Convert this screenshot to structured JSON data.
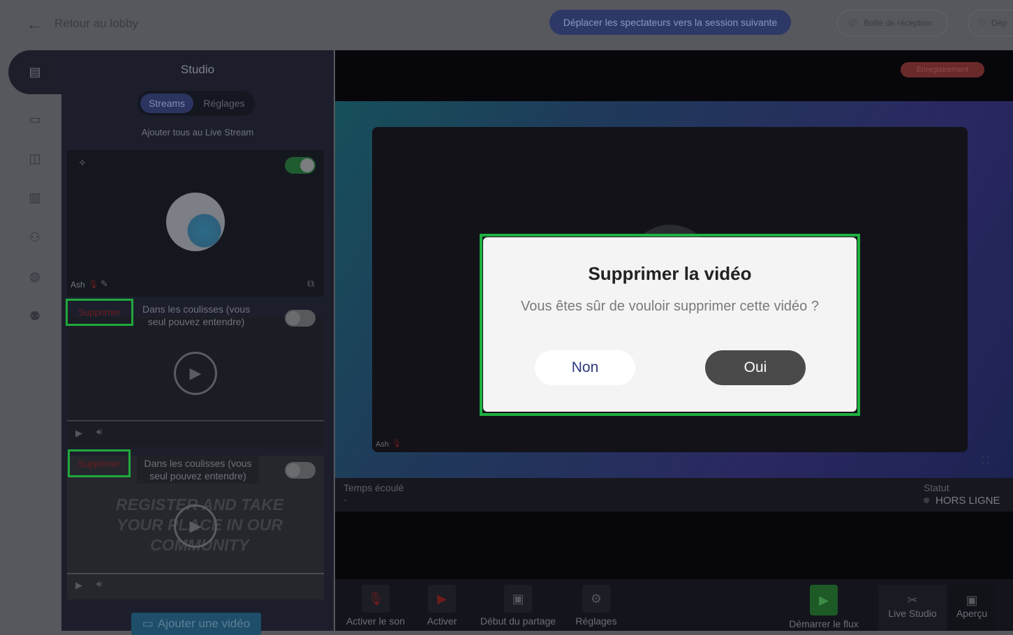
{
  "header": {
    "back_label": "Retour au lobby",
    "move_viewers": "Déplacer les spectateurs vers la session suivante",
    "inbox": "Boîte de réception",
    "next_btn": "Dép"
  },
  "panel": {
    "title": "Studio",
    "tabs": [
      {
        "label": "Streams",
        "active": true
      },
      {
        "label": "Réglages",
        "active": false
      }
    ],
    "add_all": "Ajouter tous au Live Stream",
    "participant": {
      "name": "Ash",
      "live_toggle": true
    },
    "videos": [
      {
        "delete": "Supprimer",
        "backstage": "Dans les coulisses (vous seul pouvez entendre)",
        "toggle": false
      },
      {
        "delete": "Supprimer",
        "backstage": "Dans les coulisses (vous seul pouvez entendre)",
        "toggle": false,
        "thumbnail_text": "REGISTER AND TAKE YOUR PLACE IN OUR COMMUNITY"
      }
    ],
    "add_video": "Ajouter une vidéo"
  },
  "stage": {
    "recording": "Enregistrement",
    "speaker": "Ash",
    "elapsed_label": "Temps écoulé",
    "elapsed_value": "-",
    "status_label": "Statut",
    "status_value": "HORS LIGNE"
  },
  "toolbar": {
    "unmute": "Activer le son",
    "camera": "Activer",
    "share": "Début du partage",
    "settings": "Réglages",
    "start": "Démarrer le flux",
    "live_studio": "Live Studio",
    "preview": "Aperçu"
  },
  "dialog": {
    "title": "Supprimer la vidéo",
    "message": "Vous êtes sûr de vouloir supprimer cette vidéo ?",
    "no": "Non",
    "yes": "Oui"
  },
  "colors": {
    "highlight": "#1fb141",
    "accent": "#2e3866",
    "delete_text": "#6d1c1c"
  }
}
